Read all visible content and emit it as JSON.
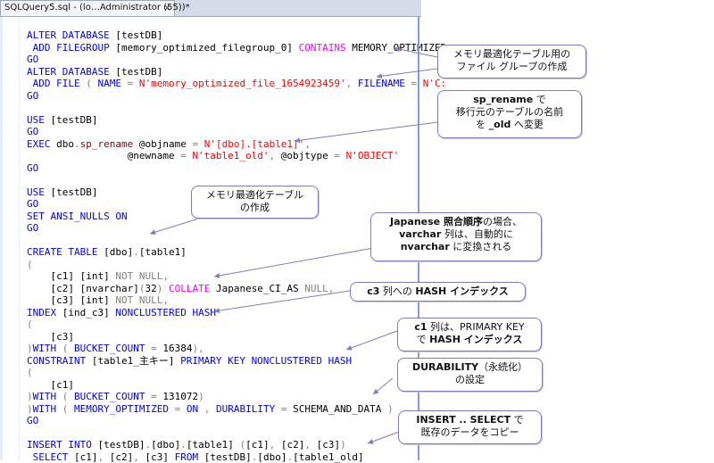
{
  "tab": {
    "title": "SQLQuery5.sql - (lo…Administrator (55))*",
    "close": "×"
  },
  "code": [
    [
      [
        "kw",
        "ALTER DATABASE "
      ],
      [
        "t",
        "[testDB]"
      ]
    ],
    [
      [
        "t",
        " "
      ],
      [
        "kw",
        "ADD FILEGROUP "
      ],
      [
        "t",
        "[memory_optimized_filegroup_0] "
      ],
      [
        "sys",
        "CONTAINS "
      ],
      [
        "t",
        "MEMORY_OPTIMIZED"
      ]
    ],
    [
      [
        "kw",
        "GO"
      ]
    ],
    [
      [
        "kw",
        "ALTER DATABASE "
      ],
      [
        "t",
        "[testDB]"
      ]
    ],
    [
      [
        "t",
        " "
      ],
      [
        "kw",
        "ADD FILE "
      ],
      [
        "gray",
        "( "
      ],
      [
        "kw",
        "NAME "
      ],
      [
        "gray",
        "= "
      ],
      [
        "str",
        "N'memory_optimized_file_1654923459'"
      ],
      [
        "gray",
        ", "
      ],
      [
        "kw",
        "FILENAME "
      ],
      [
        "gray",
        "= "
      ],
      [
        "str",
        "N'C:"
      ]
    ],
    [
      [
        "kw",
        "GO"
      ]
    ],
    [
      [
        "t",
        ""
      ]
    ],
    [
      [
        "kw",
        "USE "
      ],
      [
        "t",
        "[testDB]"
      ]
    ],
    [
      [
        "kw",
        "GO"
      ]
    ],
    [
      [
        "kw",
        "EXEC "
      ],
      [
        "t",
        "dbo"
      ],
      [
        "gray",
        "."
      ],
      [
        "fn",
        "sp_rename "
      ],
      [
        "t",
        "@objname "
      ],
      [
        "gray",
        "= "
      ],
      [
        "str",
        "N'[dbo].[table1]'"
      ],
      [
        "gray",
        ","
      ]
    ],
    [
      [
        "t",
        "                 @newname "
      ],
      [
        "gray",
        "= "
      ],
      [
        "str",
        "N'table1_old'"
      ],
      [
        "gray",
        ", "
      ],
      [
        "t",
        "@objtype "
      ],
      [
        "gray",
        "= "
      ],
      [
        "str",
        "N'OBJECT'"
      ]
    ],
    [
      [
        "kw",
        "GO"
      ]
    ],
    [
      [
        "t",
        ""
      ]
    ],
    [
      [
        "kw",
        "USE "
      ],
      [
        "t",
        "[testDB]"
      ]
    ],
    [
      [
        "kw",
        "GO"
      ]
    ],
    [
      [
        "kw",
        "SET ANSI_NULLS ON"
      ]
    ],
    [
      [
        "kw",
        "GO"
      ]
    ],
    [
      [
        "t",
        ""
      ]
    ],
    [
      [
        "kw",
        "CREATE TABLE "
      ],
      [
        "t",
        "[dbo]"
      ],
      [
        "gray",
        "."
      ],
      [
        "t",
        "[table1]"
      ]
    ],
    [
      [
        "gray",
        "("
      ]
    ],
    [
      [
        "t",
        "    [c1] [int] "
      ],
      [
        "gray",
        "NOT NULL,"
      ]
    ],
    [
      [
        "t",
        "    [c2] [nvarchar]"
      ],
      [
        "gray",
        "("
      ],
      [
        "t",
        "32"
      ],
      [
        "gray",
        ") "
      ],
      [
        "sys",
        "COLLATE "
      ],
      [
        "t",
        "Japanese_CI_AS "
      ],
      [
        "gray",
        "NULL,"
      ]
    ],
    [
      [
        "t",
        "    [c3] [int] "
      ],
      [
        "gray",
        "NOT NULL,"
      ]
    ],
    [
      [
        "kw",
        "INDEX "
      ],
      [
        "t",
        "[ind_c3] "
      ],
      [
        "kw",
        "NONCLUSTERED HASH"
      ]
    ],
    [
      [
        "gray",
        "("
      ]
    ],
    [
      [
        "t",
        "    [c3]"
      ]
    ],
    [
      [
        "gray",
        ")"
      ],
      [
        "kw",
        "WITH "
      ],
      [
        "gray",
        "( "
      ],
      [
        "kw",
        "BUCKET_COUNT "
      ],
      [
        "gray",
        "= "
      ],
      [
        "t",
        "16384"
      ],
      [
        "gray",
        "),"
      ]
    ],
    [
      [
        "kw",
        "CONSTRAINT "
      ],
      [
        "t",
        "[table1_主キー] "
      ],
      [
        "kw",
        "PRIMARY KEY NONCLUSTERED HASH"
      ]
    ],
    [
      [
        "gray",
        "("
      ]
    ],
    [
      [
        "t",
        "    [c1]"
      ]
    ],
    [
      [
        "gray",
        ")"
      ],
      [
        "kw",
        "WITH "
      ],
      [
        "gray",
        "( "
      ],
      [
        "kw",
        "BUCKET_COUNT "
      ],
      [
        "gray",
        "= "
      ],
      [
        "t",
        "131072"
      ],
      [
        "gray",
        ")"
      ]
    ],
    [
      [
        "gray",
        ")"
      ],
      [
        "kw",
        "WITH "
      ],
      [
        "gray",
        "( "
      ],
      [
        "kw",
        "MEMORY_OPTIMIZED "
      ],
      [
        "gray",
        "= "
      ],
      [
        "kw",
        "ON "
      ],
      [
        "gray",
        ", "
      ],
      [
        "kw",
        "DURABILITY "
      ],
      [
        "gray",
        "= "
      ],
      [
        "t",
        "SCHEMA_AND_DATA "
      ],
      [
        "gray",
        ")"
      ]
    ],
    [
      [
        "kw",
        "GO"
      ]
    ],
    [
      [
        "t",
        ""
      ]
    ],
    [
      [
        "kw",
        "INSERT INTO "
      ],
      [
        "t",
        "[testDB]"
      ],
      [
        "gray",
        "."
      ],
      [
        "t",
        "[dbo]"
      ],
      [
        "gray",
        "."
      ],
      [
        "t",
        "[table1] "
      ],
      [
        "gray",
        "("
      ],
      [
        "t",
        "[c1]"
      ],
      [
        "gray",
        ", "
      ],
      [
        "t",
        "[c2]"
      ],
      [
        "gray",
        ", "
      ],
      [
        "t",
        "[c3]"
      ],
      [
        "gray",
        ")"
      ]
    ],
    [
      [
        "t",
        " "
      ],
      [
        "kw",
        "SELECT "
      ],
      [
        "t",
        "[c1]"
      ],
      [
        "gray",
        ", "
      ],
      [
        "t",
        "[c2]"
      ],
      [
        "gray",
        ", "
      ],
      [
        "t",
        "[c3] "
      ],
      [
        "kw",
        "FROM "
      ],
      [
        "t",
        "[testDB]"
      ],
      [
        "gray",
        "."
      ],
      [
        "t",
        "[dbo]"
      ],
      [
        "gray",
        "."
      ],
      [
        "t",
        "[table1_old]"
      ]
    ]
  ],
  "callouts": {
    "c1": {
      "l1": "メモリ最適化テーブル用の",
      "l2": "ファイル グループの作成"
    },
    "c2": {
      "b1": "sp_rename",
      "t1": " で",
      "l2": "移行元のテーブルの名前",
      "l3a": "を ",
      "b3": "_old",
      "l3b": " へ変更"
    },
    "c3": {
      "l1": "メモリ最適化テーブル",
      "l2": "の作成"
    },
    "c4": {
      "b1": "Japanese 照合順序",
      "t1": "の場合、",
      "b2": "varchar",
      "t2": " 列は、自動的に",
      "b3": "nvarchar",
      "t3": " に変換される"
    },
    "c5": {
      "b1": "c3",
      "t1": " 列への ",
      "b2": "HASH インデックス"
    },
    "c6": {
      "b1": "c1",
      "t1": " 列は、PRIMARY KEY",
      "l2a": "で ",
      "b2": "HASH インデックス"
    },
    "c7": {
      "b1": "DURABILITY",
      "t1": "（永続化）",
      "l2": "の設定"
    },
    "c8": {
      "b1": "INSERT .. SELECT",
      "t1": " で",
      "l2": "既存のデータをコピー"
    }
  },
  "colors": {
    "keyword": "#0000ff",
    "string": "#ff0000",
    "proc": "#800000",
    "system": "#ff00ff",
    "operator": "#808080",
    "callout_border": "#7f7bbd"
  }
}
